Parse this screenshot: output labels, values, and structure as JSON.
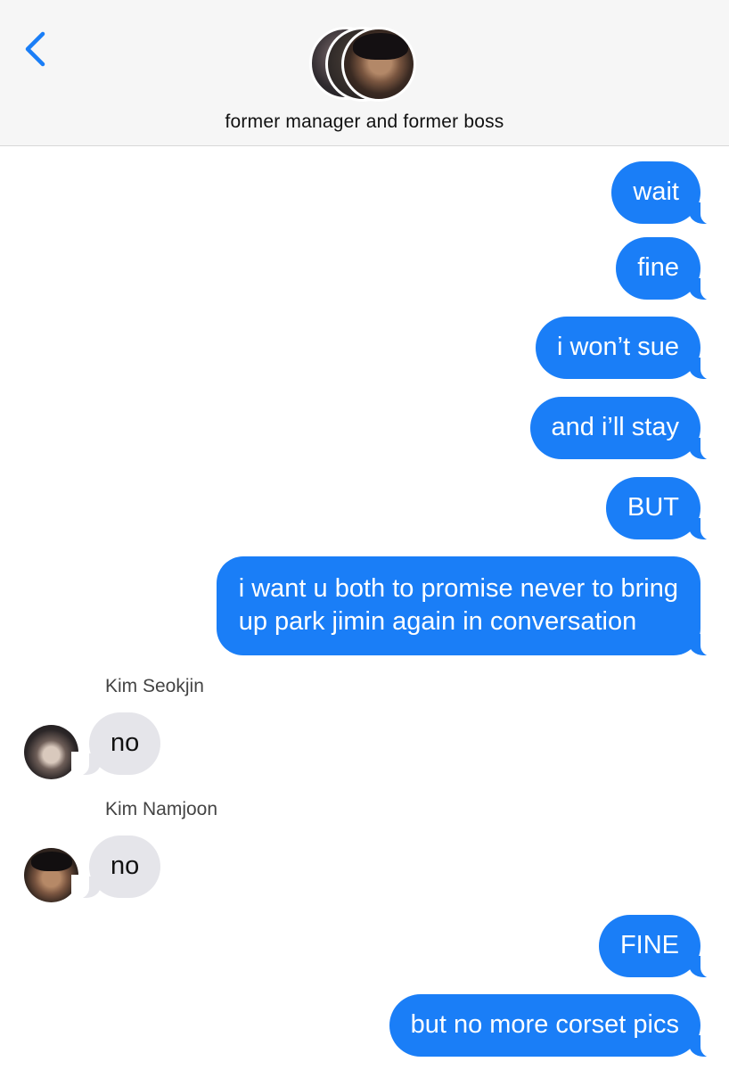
{
  "header": {
    "back_icon": "chevron-left-icon",
    "group_name": "former manager and former boss",
    "accent_color": "#1a7ef7"
  },
  "messages": [
    {
      "direction": "outgoing",
      "text": "wait"
    },
    {
      "direction": "outgoing",
      "text": "fine"
    },
    {
      "direction": "outgoing",
      "text": "i won’t sue"
    },
    {
      "direction": "outgoing",
      "text": "and i’ll stay"
    },
    {
      "direction": "outgoing",
      "text": "BUT"
    },
    {
      "direction": "outgoing",
      "lines": [
        "i want u both to promise never to bring",
        "up park jimin again in conversation"
      ]
    },
    {
      "direction": "incoming",
      "sender": "Kim Seokjin",
      "text": "no"
    },
    {
      "direction": "incoming",
      "sender": "Kim Namjoon",
      "text": "no"
    },
    {
      "direction": "outgoing",
      "text": "FINE"
    },
    {
      "direction": "outgoing",
      "text": "but no more corset pics"
    }
  ],
  "colors": {
    "outgoing_bubble": "#1a7ef7",
    "incoming_bubble": "#e5e5ea",
    "header_background": "#f6f6f6"
  }
}
